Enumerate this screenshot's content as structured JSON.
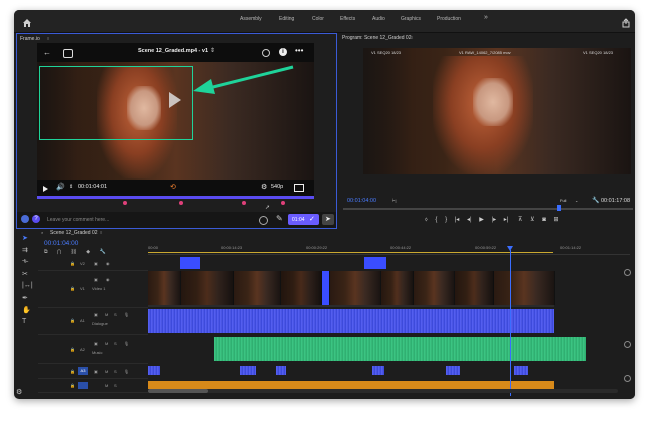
{
  "workspaces": [
    "Assembly",
    "Editing",
    "Color",
    "Effects",
    "Audio",
    "Graphics",
    "Production"
  ],
  "more_workspaces": "»",
  "left_panel": {
    "title": "Frame.io",
    "video_title": "Scene 12_Graded.mp4 - v1",
    "timecode": "00:01:04:01",
    "resolution": "540p",
    "comment_placeholder": "Leave your comment here...",
    "comment_timecode": "01:04"
  },
  "program": {
    "title": "Program: Scene 12_Graded 02",
    "overlay_left": "V1  SEQ20 18/23",
    "overlay_mid": "V1  RAW_14062_7/2085 mov",
    "overlay_right": "V1  SEQ20 18/23",
    "timecode": "00:01:04:00",
    "fit": "Full",
    "duration": "00:01:17:08"
  },
  "timeline": {
    "sequence_tab": "Scene 12_Graded 02",
    "timecode": "00:01:04:00",
    "ruler": [
      "00:00",
      "00:00:14:23",
      "00:00:29:22",
      "00:00:44:22",
      "00:00:59:22",
      "00:01:14:22"
    ],
    "tracks": [
      {
        "id": "V2",
        "name": ""
      },
      {
        "id": "V1",
        "name": "Video 1"
      },
      {
        "id": "A1",
        "name": "Dialogue"
      },
      {
        "id": "A2",
        "name": "Music"
      },
      {
        "id": "A3",
        "name": ""
      }
    ],
    "playhead_fraction": 0.87
  },
  "colors": {
    "accent": "#6a5cff",
    "arrow": "#1fd39a",
    "dialogue": "#4a55f0",
    "music": "#3fd08a",
    "marker": "#3a4dff"
  }
}
